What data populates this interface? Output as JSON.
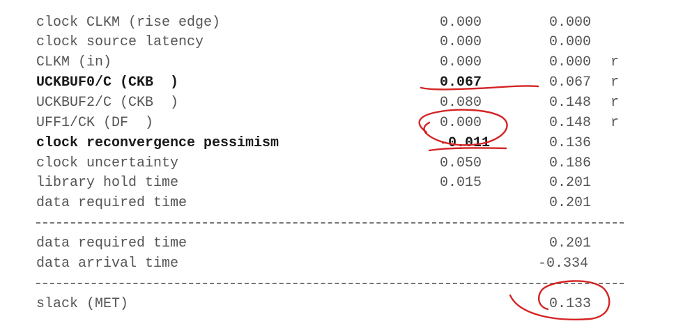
{
  "rows": [
    {
      "label": "clock CLKM (rise edge)",
      "incr": "0.000",
      "path": "0.000",
      "flag": "",
      "bold": false
    },
    {
      "label": "clock source latency",
      "incr": "0.000",
      "path": "0.000",
      "flag": "",
      "bold": false
    },
    {
      "label": "CLKM (in)",
      "incr": "0.000",
      "path": "0.000",
      "flag": "r",
      "bold": false
    },
    {
      "label": "UCKBUF0/C (CKB  )",
      "incr": "0.067",
      "path": "0.067",
      "flag": "r",
      "bold": true
    },
    {
      "label": "UCKBUF2/C (CKB  )",
      "incr": "0.080",
      "path": "0.148",
      "flag": "r",
      "bold": false
    },
    {
      "label": "UFF1/CK (DF  )",
      "incr": "0.000",
      "path": "0.148",
      "flag": "r",
      "bold": false
    },
    {
      "label": "clock reconvergence pessimism",
      "incr": "-0.011",
      "path": "0.136",
      "flag": "",
      "bold": true
    },
    {
      "label": "clock uncertainty",
      "incr": "0.050",
      "path": "0.186",
      "flag": "",
      "bold": false
    },
    {
      "label": "library hold time",
      "incr": "0.015",
      "path": "0.201",
      "flag": "",
      "bold": false
    },
    {
      "label": "data required time",
      "incr": "",
      "path": "0.201",
      "flag": "",
      "bold": false
    }
  ],
  "summary": [
    {
      "label": "data required time",
      "path": "0.201"
    },
    {
      "label": "data arrival time",
      "path": "-0.334"
    }
  ],
  "slack": {
    "label": "slack (MET)",
    "value": "0.133"
  },
  "colors": {
    "text": "#555555",
    "bold_text": "#1a1a1a",
    "annotation": "#d42424"
  }
}
